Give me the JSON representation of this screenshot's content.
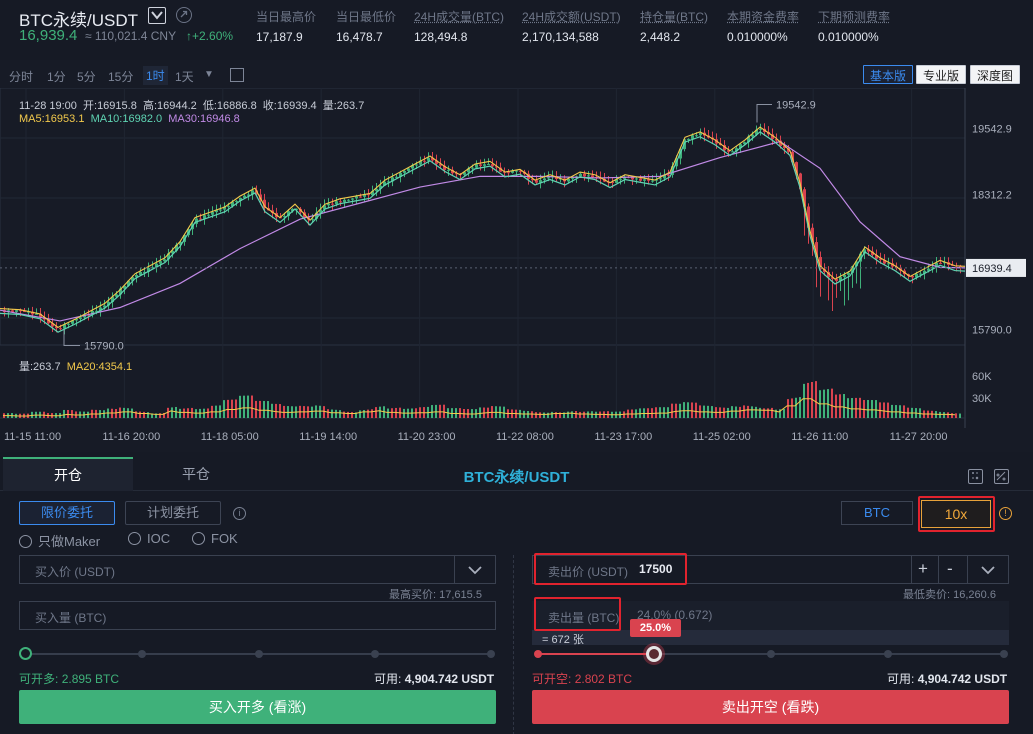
{
  "header": {
    "symbol": "BTC永续/USDT",
    "last_price": "16,939.4",
    "cny_price": "≈ 110,021.4 CNY",
    "change": "+2.60%",
    "stats": [
      {
        "label": "当日最高价",
        "value": "17,187.9"
      },
      {
        "label": "当日最低价",
        "value": "16,478.7"
      },
      {
        "label": "24H成交量(BTC)",
        "value": "128,494.8"
      },
      {
        "label": "24H成交额(USDT)",
        "value": "2,170,134,588"
      },
      {
        "label": "持仓量(BTC)",
        "value": "2,448.2"
      },
      {
        "label": "本期资金费率",
        "value": "0.010000%"
      },
      {
        "label": "下期预测费率",
        "value": "0.010000%"
      }
    ]
  },
  "chart_toolbar": {
    "timeframes": [
      "分时",
      "1分",
      "5分",
      "15分",
      "1时",
      "1天"
    ],
    "active_timeframe": "1时",
    "view_buttons": [
      "基本版",
      "专业版",
      "深度图"
    ],
    "active_view": "基本版"
  },
  "chart_data": {
    "type": "candlestick",
    "ohlc_text": "11-28 19:00  开:16915.8  高:16944.2  低:16886.8  收:16939.4  量:263.7",
    "ma_labels": [
      {
        "text": "MA5:16953.1",
        "color": "#f2c94c"
      },
      {
        "text": "MA10:16982.0",
        "color": "#5fd4b3"
      },
      {
        "text": "MA30:16946.8",
        "color": "#c18ae6"
      }
    ],
    "y_ticks": [
      "19542.9",
      "18312.2",
      "15790.0"
    ],
    "current_price_label": "16939.4",
    "max_annotation": "19542.9",
    "min_annotation": "15790.0",
    "ylim": [
      15500,
      20300
    ],
    "volume_labels": [
      {
        "text": "量:263.7",
        "color": "#c7ccd6"
      },
      {
        "text": "MA20:4354.1",
        "color": "#f2c94c"
      }
    ],
    "volume_ticks": [
      "60K",
      "30K"
    ],
    "x_ticks": [
      "11-15 11:00",
      "11-16 20:00",
      "11-18 05:00",
      "11-19 14:00",
      "11-20 23:00",
      "11-22 08:00",
      "11-23 17:00",
      "11-25 02:00",
      "11-26 11:00",
      "11-27 20:00"
    ],
    "price_path": [
      [
        0,
        16150
      ],
      [
        20,
        16130
      ],
      [
        40,
        16050
      ],
      [
        58,
        15800
      ],
      [
        75,
        15950
      ],
      [
        90,
        16100
      ],
      [
        105,
        16250
      ],
      [
        120,
        16500
      ],
      [
        135,
        16800
      ],
      [
        150,
        16950
      ],
      [
        165,
        17100
      ],
      [
        180,
        17400
      ],
      [
        195,
        17850
      ],
      [
        210,
        17950
      ],
      [
        225,
        18050
      ],
      [
        240,
        18250
      ],
      [
        255,
        18400
      ],
      [
        265,
        18050
      ],
      [
        280,
        17850
      ],
      [
        295,
        18100
      ],
      [
        310,
        17800
      ],
      [
        325,
        18100
      ],
      [
        340,
        18200
      ],
      [
        355,
        18250
      ],
      [
        370,
        18300
      ],
      [
        385,
        18550
      ],
      [
        400,
        18700
      ],
      [
        415,
        18850
      ],
      [
        430,
        19000
      ],
      [
        445,
        18800
      ],
      [
        460,
        18650
      ],
      [
        475,
        18850
      ],
      [
        490,
        18900
      ],
      [
        505,
        18700
      ],
      [
        520,
        18750
      ],
      [
        535,
        18550
      ],
      [
        550,
        18650
      ],
      [
        565,
        18550
      ],
      [
        580,
        18700
      ],
      [
        595,
        18650
      ],
      [
        610,
        18500
      ],
      [
        625,
        18650
      ],
      [
        640,
        18600
      ],
      [
        655,
        18550
      ],
      [
        670,
        18700
      ],
      [
        685,
        19350
      ],
      [
        700,
        19450
      ],
      [
        715,
        19300
      ],
      [
        730,
        19100
      ],
      [
        745,
        19300
      ],
      [
        760,
        19540
      ],
      [
        775,
        19350
      ],
      [
        790,
        19100
      ],
      [
        800,
        18500
      ],
      [
        810,
        17600
      ],
      [
        820,
        16950
      ],
      [
        835,
        16700
      ],
      [
        850,
        16850
      ],
      [
        865,
        17300
      ],
      [
        880,
        17100
      ],
      [
        895,
        16950
      ],
      [
        910,
        16750
      ],
      [
        925,
        16900
      ],
      [
        940,
        17050
      ],
      [
        955,
        16950
      ],
      [
        965,
        16940
      ]
    ],
    "ma_slow_path": [
      [
        0,
        16150
      ],
      [
        60,
        15950
      ],
      [
        120,
        16200
      ],
      [
        180,
        16650
      ],
      [
        240,
        17300
      ],
      [
        300,
        17850
      ],
      [
        360,
        18150
      ],
      [
        420,
        18450
      ],
      [
        480,
        18650
      ],
      [
        540,
        18650
      ],
      [
        600,
        18620
      ],
      [
        660,
        18650
      ],
      [
        720,
        19000
      ],
      [
        780,
        19300
      ],
      [
        820,
        18800
      ],
      [
        860,
        17800
      ],
      [
        900,
        17150
      ],
      [
        940,
        16950
      ],
      [
        965,
        16940
      ]
    ],
    "volume_series": [
      0.12,
      0.1,
      0.14,
      0.11,
      0.18,
      0.15,
      0.2,
      0.25,
      0.3,
      0.22,
      0.18,
      0.35,
      0.28,
      0.24,
      0.3,
      0.42,
      0.5,
      0.38,
      0.32,
      0.28,
      0.3,
      0.34,
      0.26,
      0.22,
      0.3,
      0.36,
      0.28,
      0.24,
      0.26,
      0.3,
      0.22,
      0.2,
      0.24,
      0.28,
      0.22,
      0.2,
      0.18,
      0.22,
      0.24,
      0.2,
      0.18,
      0.16,
      0.2,
      0.22,
      0.24,
      0.32,
      0.36,
      0.3,
      0.28,
      0.34,
      0.4,
      0.38,
      0.3,
      0.6,
      0.95,
      0.7,
      0.55,
      0.45,
      0.4,
      0.35,
      0.3,
      0.25,
      0.2,
      0.18,
      0.16
    ]
  },
  "trade": {
    "tab_open": "开仓",
    "tab_close": "平仓",
    "title": "BTC永续/USDT",
    "order_types": [
      "限价委托",
      "计划委托"
    ],
    "options": [
      "只做Maker",
      "IOC",
      "FOK"
    ],
    "unit_button": "BTC",
    "leverage": "10x",
    "buy": {
      "price_placeholder": "买入价 (USDT)",
      "best_price_label": "最高买价:",
      "best_price_value": "17,615.5",
      "amount_placeholder": "买入量 (BTC)",
      "can_open_label": "可开多:",
      "can_open_value": "2.895 BTC",
      "available_label": "可用:",
      "available_value": "4,904.742 USDT",
      "button": "买入开多 (看涨)",
      "slider_percent": 0
    },
    "sell": {
      "price_label": "卖出价 (USDT)",
      "price_value": "17500",
      "plus": "+",
      "minus": "-",
      "best_price_label": "最低卖价:",
      "best_price_value": "16,260.6",
      "amount_label": "卖出量 (BTC)",
      "amount_value": "24.0% (0.672)",
      "contracts": "= 672 张",
      "slider_tooltip": "25.0%",
      "slider_percent": 25,
      "can_open_label": "可开空:",
      "can_open_value": "2.802 BTC",
      "available_label": "可用:",
      "available_value": "4,904.742 USDT",
      "button": "卖出开空 (看跌)"
    },
    "colors": {
      "buy": "#3fb17a",
      "sell": "#d9434f",
      "accent": "#3b8bef",
      "leverage": "#f2a93b",
      "highlight": "#e1232e"
    }
  }
}
